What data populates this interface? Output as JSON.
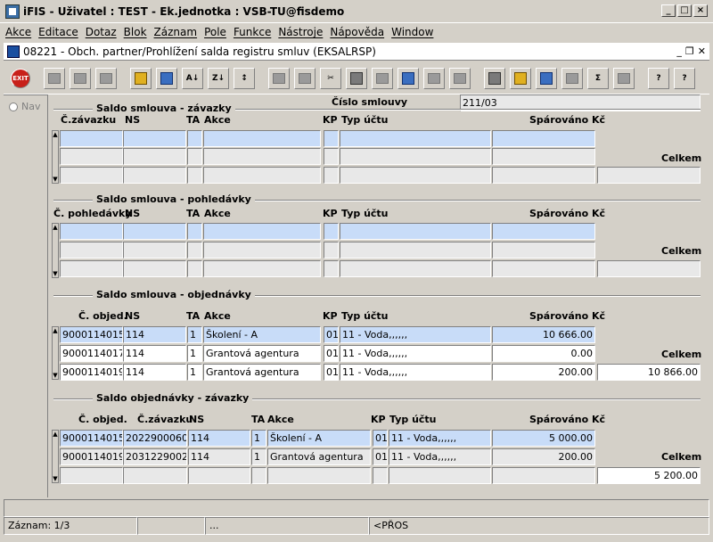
{
  "window": {
    "title": "iFIS - Uživatel : TEST - Ek.jednotka : VSB-TU@fisdemo"
  },
  "menu": [
    "Akce",
    "Editace",
    "Dotaz",
    "Blok",
    "Záznam",
    "Pole",
    "Funkce",
    "Nástroje",
    "Nápověda",
    "Window"
  ],
  "form": {
    "title": "08221 - Obch. partner/Prohlížení salda registru smluv (EKSALRSP)"
  },
  "toolbar": {
    "exit_label": "EXIT",
    "sum_label": "Σ",
    "help_label": "?"
  },
  "nav": {
    "label": "Nav"
  },
  "contract": {
    "label": "Číslo smlouvy",
    "value": "211/03"
  },
  "sec1": {
    "title": "Saldo smlouva - závazky",
    "headers": {
      "a": "Č.závazku",
      "b": "NS",
      "c": "TA",
      "d": "Akce",
      "e": "KP",
      "f": "Typ účtu",
      "g": "Spárováno Kč"
    },
    "total_label": "Celkem",
    "total_value": ""
  },
  "sec2": {
    "title": "Saldo smlouva - pohledávky",
    "headers": {
      "a": "Č. pohledávky",
      "b": "NS",
      "c": "TA",
      "d": "Akce",
      "e": "KP",
      "f": "Typ účtu",
      "g": "Spárováno Kč"
    },
    "total_label": "Celkem",
    "total_value": ""
  },
  "sec3": {
    "title": "Saldo smlouva - objednávky",
    "headers": {
      "a": "Č. objed.",
      "b": "NS",
      "c": "TA",
      "d": "Akce",
      "e": "KP",
      "f": "Typ účtu",
      "g": "Spárováno Kč"
    },
    "rows": [
      {
        "a": "9000114015",
        "b": "114",
        "c": "1",
        "d": "Školení - A",
        "e": "01",
        "f": "11 - Voda,,,,,,",
        "g": "10 666.00"
      },
      {
        "a": "9000114017",
        "b": "114",
        "c": "1",
        "d": "Grantová agentura",
        "e": "01",
        "f": "11 - Voda,,,,,,",
        "g": "0.00"
      },
      {
        "a": "9000114019",
        "b": "114",
        "c": "1",
        "d": "Grantová agentura",
        "e": "01",
        "f": "11 - Voda,,,,,,",
        "g": "200.00"
      }
    ],
    "total_label": "Celkem",
    "total_value": "10 866.00"
  },
  "sec4": {
    "title": "Saldo objednávky - závazky",
    "headers": {
      "a": "Č. objed.",
      "h": "Č.závazku",
      "b": "NS",
      "c": "TA",
      "d": "Akce",
      "e": "KP",
      "f": "Typ účtu",
      "g": "Spárováno Kč"
    },
    "rows": [
      {
        "a": "9000114015",
        "h": "2022900060",
        "b": "114",
        "c": "1",
        "d": "Školení - A",
        "e": "01",
        "f": "11 - Voda,,,,,,",
        "g": "5 000.00"
      },
      {
        "a": "9000114019",
        "h": "2031229002",
        "b": "114",
        "c": "1",
        "d": "Grantová agentura",
        "e": "01",
        "f": "11 - Voda,,,,,,",
        "g": "200.00"
      }
    ],
    "total_label": "Celkem",
    "total_value": "5 200.00"
  },
  "status": {
    "record": "Záznam: 1/3",
    "dots": "...",
    "mode": "<PŘOS"
  }
}
